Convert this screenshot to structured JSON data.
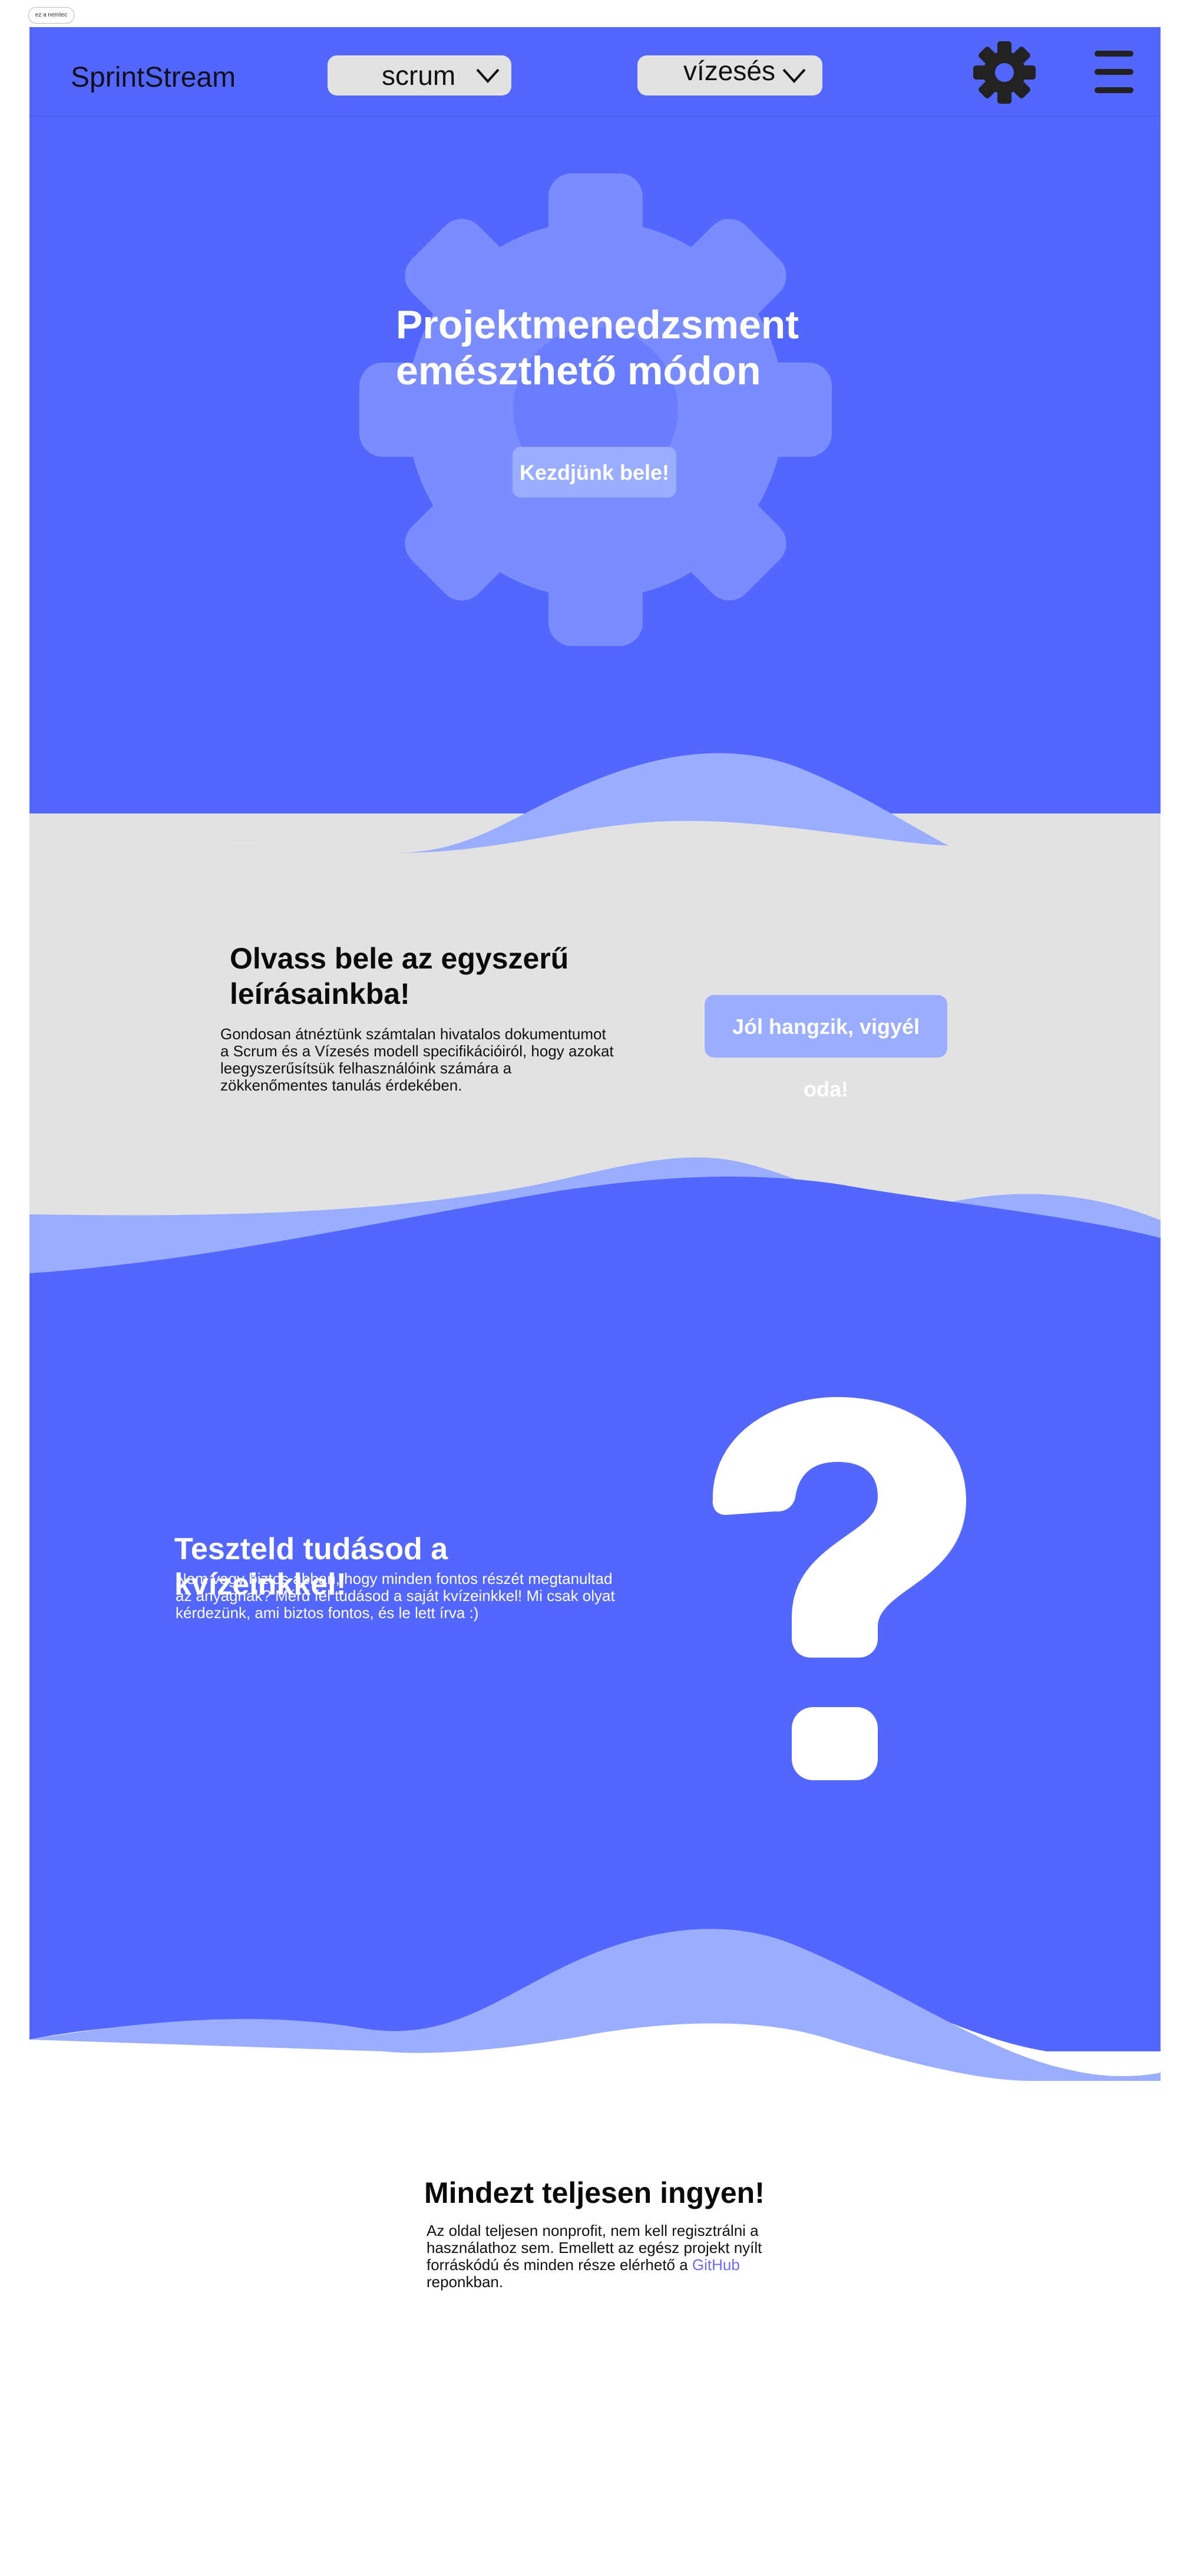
{
  "top_button": {
    "label": "ez a nemtec"
  },
  "header": {
    "brand": "SprintStream",
    "menu1": {
      "label": "scrum",
      "icon": "chevron-down-icon"
    },
    "menu2": {
      "label": "vízesés",
      "icon": "chevron-down-icon"
    },
    "settings_icon": "gear-icon",
    "menu_icon": "hamburger-icon"
  },
  "hero": {
    "title_line1": "Projektmenedzsment",
    "title_line2": "emészthető módon",
    "cta": "Kezdjünk bele!",
    "background_icon": "gear-icon"
  },
  "read": {
    "title": "Olvass bele az egyszerű leírásainkba!",
    "text": "Gondosan átnéztünk számtalan hivatalos dokumentumot a Scrum és a Vízesés modell specifikációiról, hogy azokat leegyszerűsítsük felhasználóink számára a zökkenőmentes tanulás érdekében.",
    "cta": "Jól hangzik, vigyél oda!"
  },
  "quiz": {
    "title": "Teszteld tudásod a kvízeinkkel!",
    "text": "Nem vagy biztos abban, hogy minden fontos részét megtanultad az anyagnak? Mérd fel tudásod a saját kvízeinkkel! Mi csak olyat kérdezünk, ami biztos fontos, és le lett írva :)",
    "icon": "question-mark-icon"
  },
  "free": {
    "title": "Mindezt teljesen ingyen!",
    "text_before": "Az oldal teljesen nonprofit, nem kell regisztrálni a használathoz sem. Emellett az egész projekt nyílt forráskódú és minden része elérhető a ",
    "link": "GitHub",
    "text_after": " reponkban."
  },
  "colors": {
    "primary_blue": "#5367ff",
    "light_blue": "#9aadff",
    "gray": "#e2e2e2",
    "link": "#6c6cf0",
    "icon_dark": "#222222"
  }
}
